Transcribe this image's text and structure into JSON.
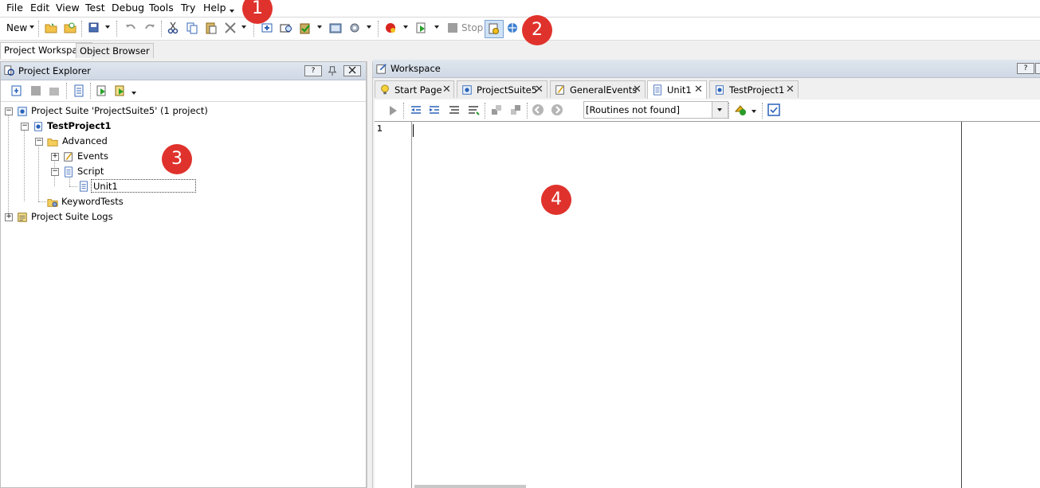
{
  "menu": [
    "File",
    "Edit",
    "View",
    "Test",
    "Debug",
    "Tools",
    "Try",
    "Help"
  ],
  "toolbar": {
    "new_label": "New",
    "stop_label": "Stop"
  },
  "workspace_tabs": [
    {
      "label": "Project Workspace",
      "active": true
    },
    {
      "label": "Object Browser",
      "active": false
    }
  ],
  "explorer": {
    "title": "Project Explorer",
    "help_btn": "?",
    "tree": {
      "suite": "Project Suite 'ProjectSuite5' (1 project)",
      "project": "TestProject1",
      "advanced": "Advanced",
      "events": "Events",
      "script": "Script",
      "unit": "Unit1",
      "keyword_tests": "KeywordTests",
      "logs": "Project Suite Logs"
    }
  },
  "workspace": {
    "title": "Workspace",
    "help_btn": "?",
    "tabs": [
      {
        "label": "Start Page",
        "active": false
      },
      {
        "label": "ProjectSuite5",
        "active": false
      },
      {
        "label": "GeneralEvents",
        "active": false
      },
      {
        "label": "Unit1",
        "active": true
      },
      {
        "label": "TestProject1",
        "active": false
      }
    ],
    "routines_select": "[Routines not found]",
    "line_numbers": [
      "1"
    ]
  },
  "badges": [
    "1",
    "2",
    "3",
    "4"
  ],
  "colors": {
    "badge": "#e0322c",
    "header": "#d6dee9",
    "accent": "#2a62b8"
  }
}
